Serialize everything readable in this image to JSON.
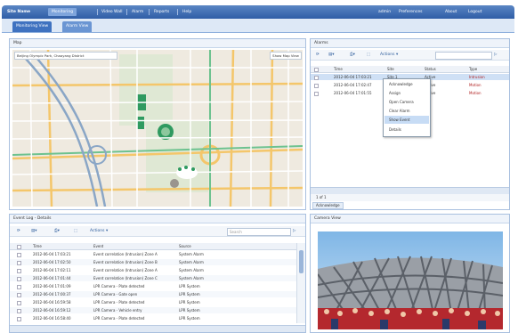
{
  "topbar": {
    "app_name": "Site Name",
    "nav": [
      "Monitoring",
      "Video Wall",
      "Alarm",
      "Reports",
      "Help"
    ],
    "user": "admin",
    "user_menu": "Preferences",
    "about": "About",
    "logout": "Logout"
  },
  "tabs": [
    "Monitoring View",
    "Alarm View"
  ],
  "map": {
    "title": "Map",
    "location_bar": "Beijing Olympic Park, Chaoyang District",
    "overlay_button": "Show Map View"
  },
  "alarm_panel": {
    "title": "Alarms",
    "actions_label": "Actions",
    "columns": [
      "Time",
      "Site",
      "Status",
      "Type"
    ],
    "rows": [
      {
        "time": "2012-06-04 17:03:21",
        "site": "Site 1",
        "status": "Active",
        "type": "Intrusion"
      },
      {
        "time": "2012-06-04 17:02:47",
        "site": "Site 1",
        "status": "Active",
        "type": "Motion"
      },
      {
        "time": "2012-06-04 17:01:55",
        "site": "Site 2",
        "status": "Active",
        "type": "Motion"
      }
    ],
    "context_menu": [
      "Acknowledge",
      "Assign",
      "Open Camera",
      "Clear Alarm",
      "Show Event",
      "Details"
    ],
    "footer_left": "1 of 1",
    "footer_button": "Acknowledge"
  },
  "event_panel": {
    "title": "Event Log - Details",
    "actions_label": "Actions",
    "search_placeholder": "Search",
    "columns": [
      "Time",
      "Event",
      "Source"
    ],
    "rows": [
      {
        "time": "2012-06-04 17:03:21",
        "event": "Event correlation (Intrusion) Zone A",
        "source": "System Alarm"
      },
      {
        "time": "2012-06-04 17:02:50",
        "event": "Event correlation (Intrusion) Zone B",
        "source": "System Alarm"
      },
      {
        "time": "2012-06-04 17:02:11",
        "event": "Event correlation (Intrusion) Zone A",
        "source": "System Alarm"
      },
      {
        "time": "2012-06-04 17:01:44",
        "event": "Event correlation (Intrusion) Zone C",
        "source": "System Alarm"
      },
      {
        "time": "2012-06-04 17:01:09",
        "event": "LPR Camera - Plate detected",
        "source": "LPR System"
      },
      {
        "time": "2012-06-04 17:00:37",
        "event": "LPR Camera - Gate open",
        "source": "LPR System"
      },
      {
        "time": "2012-06-04 16:59:58",
        "event": "LPR Camera - Plate detected",
        "source": "LPR System"
      },
      {
        "time": "2012-06-04 16:59:12",
        "event": "LPR Camera - Vehicle entry",
        "source": "LPR System"
      },
      {
        "time": "2012-06-04 16:58:40",
        "event": "LPR Camera - Plate detected",
        "source": "LPR System"
      }
    ]
  },
  "camera_panel": {
    "title": "Camera View"
  }
}
